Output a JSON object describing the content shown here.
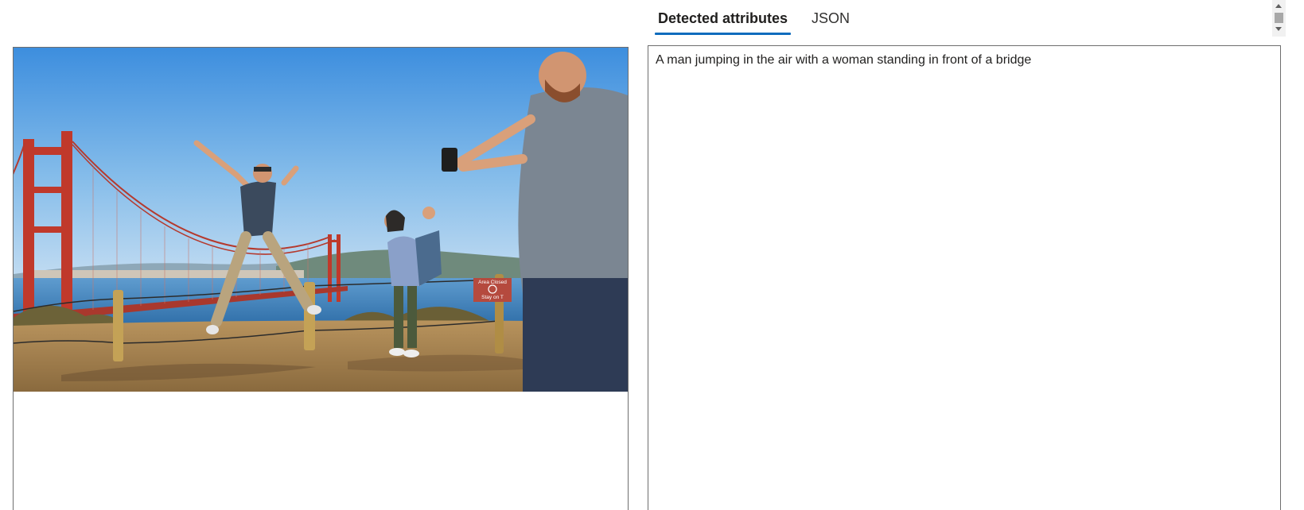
{
  "tabs": [
    {
      "label": "Detected attributes",
      "active": true
    },
    {
      "label": "JSON",
      "active": false
    }
  ],
  "result": {
    "caption": "A man jumping in the air with a woman standing in front of a bridge"
  },
  "sign": {
    "line1": "Area Closed",
    "line2": "Stay on T"
  },
  "colors": {
    "accent": "#0f6cbd",
    "panel_border": "#6e6e6e",
    "bridge": "#c0392b",
    "sky_top": "#3f8fde",
    "water": "#3b7ab8"
  },
  "icons": {
    "scroll_up": "triangle-up-icon",
    "scroll_down": "triangle-down-icon"
  }
}
